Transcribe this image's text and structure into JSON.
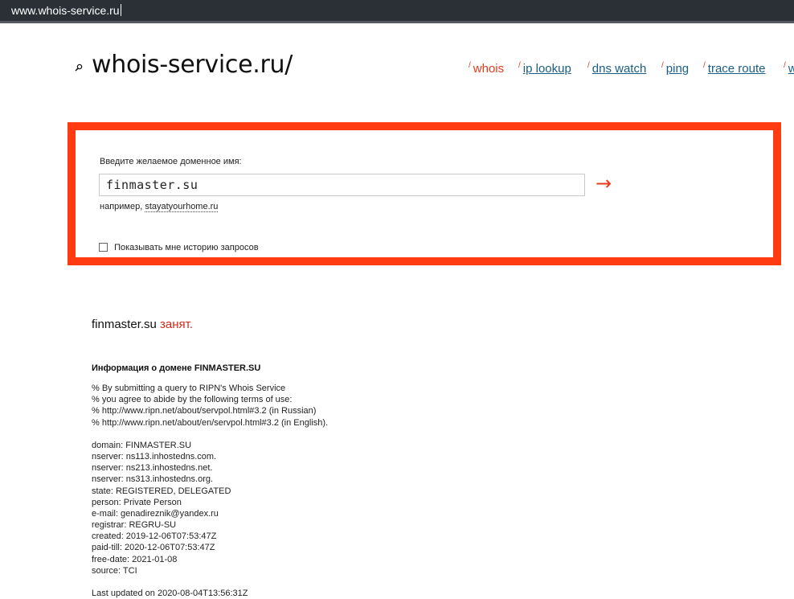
{
  "browser": {
    "url": "www.whois-service.ru"
  },
  "site": {
    "logo_text": "whois-service.ru/"
  },
  "nav": {
    "items": [
      {
        "label": "whois",
        "active": true
      },
      {
        "label": "ip lookup",
        "active": false
      },
      {
        "label": "dns watch",
        "active": false
      },
      {
        "label": "ping",
        "active": false
      },
      {
        "label": "trace route",
        "active": false
      },
      {
        "label": "w",
        "active": false
      }
    ]
  },
  "search": {
    "label": "Введите желаемое доменное имя:",
    "value": "finmaster.su",
    "submit_symbol": "→",
    "example_prefix": "например,",
    "example_domain": "stayatyourhome.ru",
    "history_label": "Показывать мне историю запросов",
    "history_checked": false
  },
  "result": {
    "domain": "finmaster.su",
    "status": "занят."
  },
  "whois": {
    "title": "Информация о домене FINMASTER.SU",
    "terms": [
      "% By submitting a query to RIPN's Whois Service",
      "% you agree to abide by the following terms of use:",
      "% http://www.ripn.net/about/servpol.html#3.2 (in Russian)",
      "% http://www.ripn.net/about/en/servpol.html#3.2 (in English)."
    ],
    "records": [
      "domain: FINMASTER.SU",
      "nserver: ns113.inhostedns.com.",
      "nserver: ns213.inhostedns.net.",
      "nserver: ns313.inhostedns.org.",
      "state: REGISTERED, DELEGATED",
      "person: Private Person",
      "e-mail: genadireznik@yandex.ru",
      "registrar: REGRU-SU",
      "created: 2019-12-06T07:53:47Z",
      "paid-till: 2020-12-06T07:53:47Z",
      "free-date: 2021-01-08",
      "source: TCI"
    ],
    "last_updated": "Last updated on 2020-08-04T13:56:31Z"
  },
  "colors": {
    "accent": "#ff3b12",
    "link": "#1a5e85",
    "status": "#d8281b",
    "url_bar": "#2b3036"
  }
}
